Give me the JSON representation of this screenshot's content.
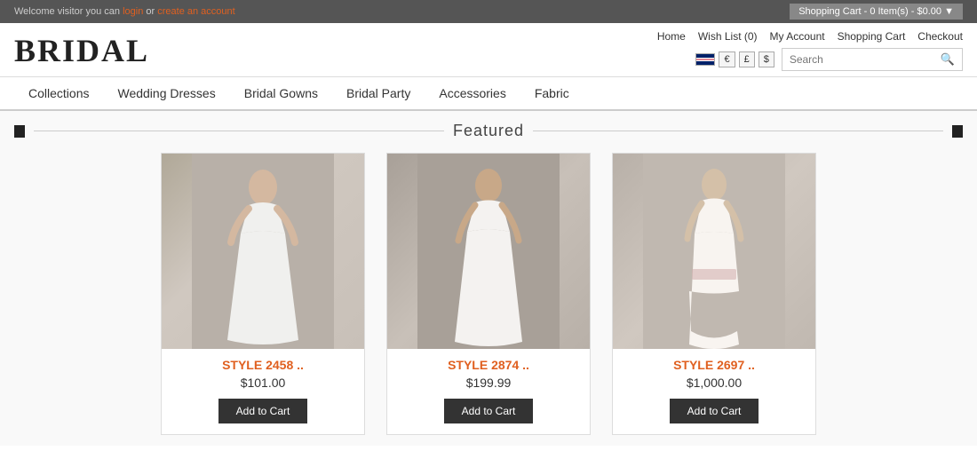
{
  "topbar": {
    "welcome_text": "Welcome visitor you can ",
    "login_label": "login",
    "or_text": " or ",
    "create_account_label": "create an account",
    "shopping_cart_label": "Shopping Cart",
    "cart_items": "0 Item(s)",
    "cart_total": "$0.00"
  },
  "header": {
    "logo": "BRIDAL",
    "links": {
      "home": "Home",
      "wish_list": "Wish List (0)",
      "my_account": "My Account",
      "shopping_cart": "Shopping Cart",
      "checkout": "Checkout"
    },
    "currency": {
      "euro": "€",
      "pound": "£",
      "dollar": "$"
    },
    "search": {
      "placeholder": "Search",
      "button_label": "🔍"
    }
  },
  "nav": {
    "items": [
      {
        "label": "Collections",
        "href": "#"
      },
      {
        "label": "Wedding Dresses",
        "href": "#"
      },
      {
        "label": "Bridal Gowns",
        "href": "#"
      },
      {
        "label": "Bridal Party",
        "href": "#"
      },
      {
        "label": "Accessories",
        "href": "#"
      },
      {
        "label": "Fabric",
        "href": "#"
      }
    ]
  },
  "featured": {
    "title": "Featured"
  },
  "products": [
    {
      "style": "STYLE 2458 ..",
      "price": "$101.00",
      "add_to_cart": "Add to Cart",
      "dress_tone": "1"
    },
    {
      "style": "STYLE 2874 ..",
      "price": "$199.99",
      "add_to_cart": "Add to Cart",
      "dress_tone": "2"
    },
    {
      "style": "STYLE 2697 ..",
      "price": "$1,000.00",
      "add_to_cart": "Add to Cart",
      "dress_tone": "3"
    }
  ]
}
